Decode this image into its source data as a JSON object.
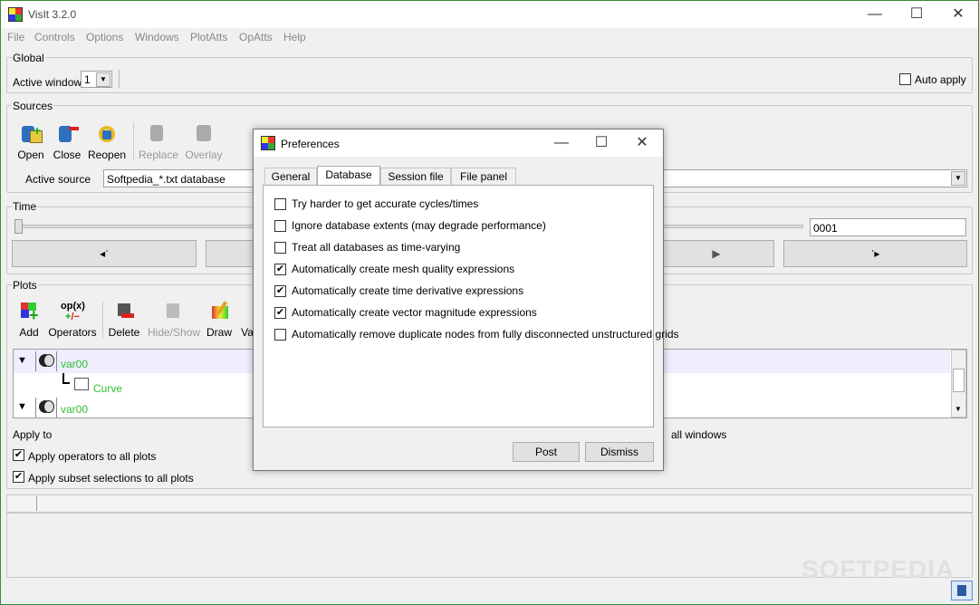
{
  "window": {
    "title": "VisIt 3.2.0",
    "minimize": "—",
    "maximize": "☐",
    "close": "✕"
  },
  "menu": [
    "File",
    "Controls",
    "Options",
    "Windows",
    "PlotAtts",
    "OpAtts",
    "Help"
  ],
  "global": {
    "label": "Global",
    "active_window_label": "Active window",
    "active_window_value": "1",
    "auto_apply": "Auto apply",
    "auto_apply_checked": false
  },
  "sources": {
    "label": "Sources",
    "open": "Open",
    "close": "Close",
    "reopen": "Reopen",
    "replace": "Replace",
    "overlay": "Overlay",
    "active_source_label": "Active source",
    "active_source_value": "Softpedia_*.txt database"
  },
  "time": {
    "label": "Time",
    "state_value": "0001",
    "prev": "◂ॱ",
    "play": "▶",
    "next": "ॱ▸"
  },
  "plots": {
    "label": "Plots",
    "add": "Add",
    "operators": "Operators",
    "delete": "Delete",
    "hide_show": "Hide/Show",
    "draw": "Draw",
    "variables": "Va",
    "tree": [
      {
        "label": "var00"
      },
      {
        "label": "Curve"
      },
      {
        "label": "var00"
      }
    ],
    "apply_to_label": "Apply to",
    "all_windows": "all windows",
    "apply_operators": "Apply operators to all plots",
    "apply_subsets": "Apply subset selections to all plots"
  },
  "watermark": "SOFTPEDIA",
  "dialog": {
    "title": "Preferences",
    "minimize": "—",
    "maximize": "☐",
    "close": "✕",
    "tabs": [
      "General",
      "Database",
      "Session file",
      "File panel"
    ],
    "active_tab": "Database",
    "options": [
      {
        "label": "Try harder to get accurate cycles/times",
        "checked": false
      },
      {
        "label": "Ignore database extents (may degrade performance)",
        "checked": false
      },
      {
        "label": "Treat all databases as time-varying",
        "checked": false
      },
      {
        "label": "Automatically create mesh quality expressions",
        "checked": true
      },
      {
        "label": "Automatically create time derivative expressions",
        "checked": true
      },
      {
        "label": "Automatically create vector magnitude expressions",
        "checked": true
      },
      {
        "label": "Automatically remove duplicate nodes from fully disconnected unstructured grids",
        "checked": false
      }
    ],
    "post": "Post",
    "dismiss": "Dismiss"
  }
}
